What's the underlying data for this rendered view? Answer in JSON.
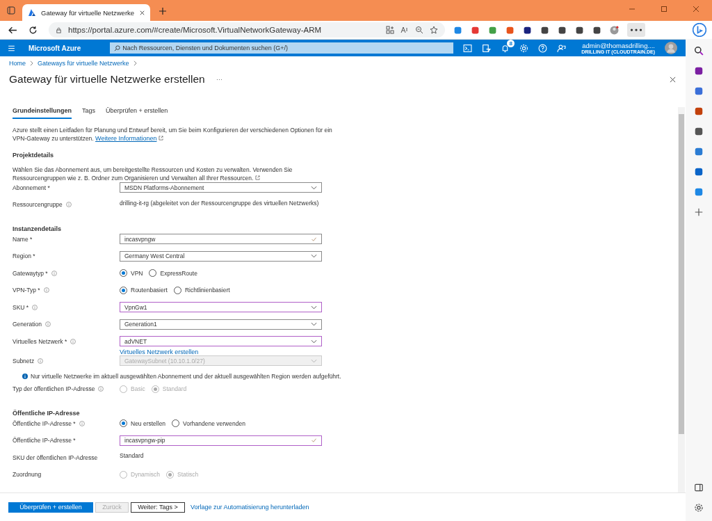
{
  "browser": {
    "tab_title": "Gateway für virtuelle Netzwerke",
    "url": "https://portal.azure.com/#create/Microsoft.VirtualNetworkGateway-ARM"
  },
  "portal": {
    "brand": "Microsoft Azure",
    "search": {
      "placeholder": "Nach Ressourcen, Diensten und Dokumenten suchen (G+/)"
    },
    "notification_count": "8",
    "account": "admin@thomasdrilling....",
    "tenant": "DRILLING IT (CLOUDTRAIN.DE)"
  },
  "breadcrumb": [
    "Home",
    "Gateways für virtuelle Netzwerke"
  ],
  "title": "Gateway für virtuelle Netzwerke erstellen",
  "tabs": [
    {
      "label": "Grundeinstellungen",
      "selected": true
    },
    {
      "label": "Tags",
      "selected": false
    },
    {
      "label": "Überprüfen + erstellen",
      "selected": false
    }
  ],
  "intro": {
    "text": "Azure stellt einen Leitfaden für Planung und Entwurf bereit, um Sie beim Konfigurieren der verschiedenen Optionen für ein VPN-Gateway zu unterstützen.",
    "link": "Weitere Informationen"
  },
  "form": [
    {
      "kind": "heading",
      "text": "Projektdetails"
    },
    {
      "kind": "paragraph",
      "text": "Wählen Sie das Abonnement aus, um bereitgestellte Ressourcen und Kosten zu verwalten. Verwenden Sie Ressourcengruppen wie z. B. Ordner zum Organisieren und Verwalten all Ihrer Ressourcen."
    },
    {
      "kind": "select",
      "label": "Abonnement *",
      "info": false,
      "value": "MSDN Platforms-Abonnement",
      "highlighted": false,
      "disabled": false
    },
    {
      "kind": "static",
      "label": "Ressourcengruppe",
      "info": true,
      "value": "drilling-it-rg (abgeleitet von der Ressourcengruppe des virtuellen Netzwerks)"
    },
    {
      "kind": "heading",
      "text": "Instanzendetails"
    },
    {
      "kind": "text",
      "label": "Name *",
      "info": false,
      "value": "incasvpngw",
      "highlighted": false,
      "valid": true
    },
    {
      "kind": "select",
      "label": "Region *",
      "info": false,
      "value": "Germany West Central",
      "highlighted": false,
      "disabled": false
    },
    {
      "kind": "radio",
      "label": "Gatewaytyp *",
      "info": true,
      "disabled": false,
      "options": [
        {
          "label": "VPN",
          "selected": true
        },
        {
          "label": "ExpressRoute",
          "selected": false
        }
      ]
    },
    {
      "kind": "radio",
      "label": "VPN-Typ *",
      "info": true,
      "disabled": false,
      "options": [
        {
          "label": "Routenbasiert",
          "selected": true
        },
        {
          "label": "Richtlinienbasiert",
          "selected": false
        }
      ]
    },
    {
      "kind": "select",
      "label": "SKU *",
      "info": true,
      "value": "VpnGw1",
      "highlighted": true,
      "disabled": false
    },
    {
      "kind": "select",
      "label": "Generation",
      "info": true,
      "value": "Generation1",
      "highlighted": false,
      "disabled": false
    },
    {
      "kind": "select",
      "label": "Virtuelles Netzwerk *",
      "info": true,
      "value": "adVNET",
      "highlighted": true,
      "disabled": false,
      "link": "Virtuelles Netzwerk erstellen"
    },
    {
      "kind": "select",
      "label": "Subnetz",
      "info": true,
      "value": "GatewaySubnet (10.10.1.0/27)",
      "highlighted": false,
      "disabled": true
    },
    {
      "kind": "note",
      "text": "Nur virtuelle Netzwerke im aktuell ausgewählten Abonnement und der aktuell ausgewählten Region werden aufgeführt."
    },
    {
      "kind": "radio",
      "label": "Typ der öffentlichen IP-Adresse",
      "info": true,
      "disabled": true,
      "options": [
        {
          "label": "Basic",
          "selected": false
        },
        {
          "label": "Standard",
          "selected": true
        }
      ]
    },
    {
      "kind": "heading",
      "text": "Öffentliche IP-Adresse"
    },
    {
      "kind": "radio",
      "label": "Öffentliche IP-Adresse *",
      "info": true,
      "disabled": false,
      "options": [
        {
          "label": "Neu erstellen",
          "selected": true
        },
        {
          "label": "Vorhandene verwenden",
          "selected": false
        }
      ]
    },
    {
      "kind": "text",
      "label": "Öffentliche IP-Adresse *",
      "info": false,
      "value": "incasvpngw-pip",
      "highlighted": true,
      "valid": true
    },
    {
      "kind": "static",
      "label": "SKU der öffentlichen IP-Adresse",
      "info": false,
      "value": "Standard"
    },
    {
      "kind": "radio",
      "label": "Zuordnung",
      "info": false,
      "disabled": true,
      "options": [
        {
          "label": "Dynamisch",
          "selected": false
        },
        {
          "label": "Statisch",
          "selected": true
        }
      ]
    }
  ],
  "footer": {
    "buttons": [
      {
        "label": "Überprüfen + erstellen",
        "kind": "primary",
        "disabled": false
      },
      {
        "label": "Zurück",
        "kind": "secondary",
        "disabled": true
      },
      {
        "label": "Weiter: Tags >",
        "kind": "secondary",
        "disabled": false
      }
    ],
    "link": "Vorlage zur Automatisierung herunterladen"
  }
}
